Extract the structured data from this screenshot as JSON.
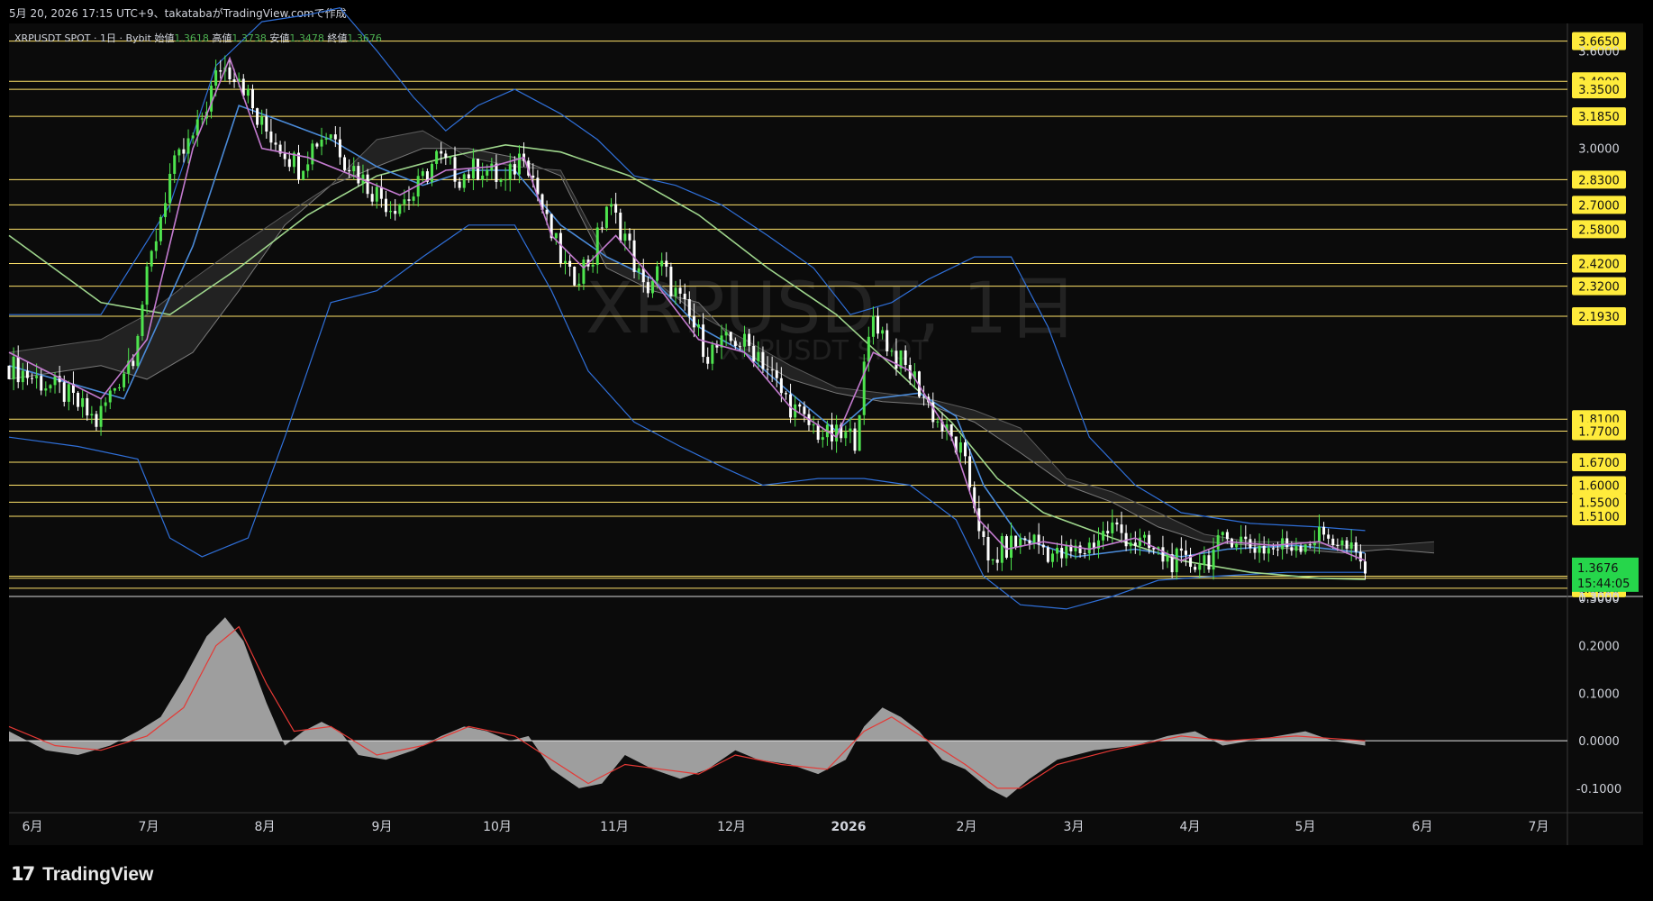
{
  "header": {
    "caption": "5月 20, 2026 17:15 UTC+9、takatabaがTradingView.comで作成"
  },
  "symbol": {
    "name": "XRPUSDT SPOT · 1日 · Bybit",
    "open_label": "始値",
    "open": "1.3618",
    "high_label": "高値",
    "high": "1.3738",
    "low_label": "安値",
    "low": "1.3478",
    "close_label": "終値",
    "close": "1.3676"
  },
  "watermark": {
    "title": "XRPUSDT, 1日",
    "subtitle": "XRPUSDT SPOT"
  },
  "footer": {
    "brand": "TradingView"
  },
  "colors": {
    "bg": "#0b0b0b",
    "up": "#4ee44e",
    "down": "#ffffff",
    "hline": "#ffe36a",
    "label_bg": "#ffeb3b",
    "price_bg": "#26d64b",
    "bb": "#2f6fd8",
    "ema_fast": "#c47bd0",
    "ema_mid": "#4a8ad8",
    "ema_slow": "#9ed58c",
    "cloud": "#7a7a7a",
    "macd": "#9e9e9e",
    "signal": "#e53935"
  },
  "chart_data": {
    "type": "candlestick",
    "symbol": "XRPUSDT SPOT",
    "timeframe": "1日",
    "exchange": "Bybit",
    "ylim": [
      1.3,
      3.7
    ],
    "y_scale": "log",
    "y_ticks": [
      "3.6000",
      "3.0000",
      "1.3000"
    ],
    "x_ticks": [
      "6月",
      "7月",
      "8月",
      "9月",
      "10月",
      "11月",
      "12月",
      "2026",
      "2月",
      "3月",
      "4月",
      "5月",
      "6月",
      "7月"
    ],
    "last_price": "1.3676",
    "countdown": "15:44:05",
    "horizontal_levels": [
      {
        "value": 3.665,
        "label": "3.6650"
      },
      {
        "value": 3.4,
        "label": "3.4000"
      },
      {
        "value": 3.35,
        "label": "3.3500"
      },
      {
        "value": 3.185,
        "label": "3.1850"
      },
      {
        "value": 2.83,
        "label": "2.8300"
      },
      {
        "value": 2.7,
        "label": "2.7000"
      },
      {
        "value": 2.58,
        "label": "2.5800"
      },
      {
        "value": 2.42,
        "label": "2.4200"
      },
      {
        "value": 2.32,
        "label": "2.3200"
      },
      {
        "value": 2.193,
        "label": "2.1930"
      },
      {
        "value": 1.81,
        "label": "1.8100"
      },
      {
        "value": 1.77,
        "label": "1.7700"
      },
      {
        "value": 1.67,
        "label": "1.6700"
      },
      {
        "value": 1.6,
        "label": "1.6000"
      },
      {
        "value": 1.55,
        "label": "1.5500"
      },
      {
        "value": 1.51,
        "label": "1.5100"
      },
      {
        "value": 1.35,
        "label": "1.3500"
      },
      {
        "value": 1.345,
        "label": "1.3450"
      },
      {
        "value": 1.32,
        "label": "1.3200"
      }
    ],
    "price_path": [
      [
        0,
        2.0
      ],
      [
        12,
        1.9
      ],
      [
        19,
        1.8
      ],
      [
        27,
        2.05
      ],
      [
        35,
        2.85
      ],
      [
        41,
        3.1
      ],
      [
        46,
        3.5
      ],
      [
        50,
        3.45
      ],
      [
        54,
        3.15
      ],
      [
        58,
        3.05
      ],
      [
        63,
        2.9
      ],
      [
        67,
        3.05
      ],
      [
        70,
        3.1
      ],
      [
        73,
        2.95
      ],
      [
        78,
        2.8
      ],
      [
        83,
        2.7
      ],
      [
        88,
        2.75
      ],
      [
        93,
        2.95
      ],
      [
        98,
        2.85
      ],
      [
        103,
        2.9
      ],
      [
        108,
        2.8
      ],
      [
        112,
        3.0
      ],
      [
        117,
        2.6
      ],
      [
        122,
        2.35
      ],
      [
        127,
        2.45
      ],
      [
        130,
        2.7
      ],
      [
        134,
        2.55
      ],
      [
        138,
        2.3
      ],
      [
        142,
        2.4
      ],
      [
        146,
        2.25
      ],
      [
        152,
        2.05
      ],
      [
        158,
        2.1
      ],
      [
        163,
        2.05
      ],
      [
        168,
        1.9
      ],
      [
        173,
        1.8
      ],
      [
        178,
        1.75
      ],
      [
        184,
        1.75
      ],
      [
        188,
        2.2
      ],
      [
        192,
        2.05
      ],
      [
        197,
        1.95
      ],
      [
        202,
        1.8
      ],
      [
        207,
        1.7
      ],
      [
        210,
        1.55
      ],
      [
        213,
        1.37
      ],
      [
        216,
        1.42
      ],
      [
        222,
        1.45
      ],
      [
        228,
        1.4
      ],
      [
        234,
        1.42
      ],
      [
        240,
        1.48
      ],
      [
        245,
        1.44
      ],
      [
        251,
        1.4
      ],
      [
        256,
        1.38
      ],
      [
        261,
        1.4
      ],
      [
        266,
        1.46
      ],
      [
        270,
        1.43
      ],
      [
        275,
        1.42
      ],
      [
        281,
        1.44
      ],
      [
        287,
        1.46
      ],
      [
        292,
        1.41
      ],
      [
        295,
        1.37
      ]
    ],
    "ema_fast": [
      [
        0,
        2.05
      ],
      [
        20,
        1.88
      ],
      [
        30,
        2.1
      ],
      [
        40,
        3.0
      ],
      [
        48,
        3.55
      ],
      [
        55,
        3.0
      ],
      [
        65,
        2.95
      ],
      [
        75,
        2.85
      ],
      [
        85,
        2.75
      ],
      [
        95,
        2.88
      ],
      [
        105,
        2.9
      ],
      [
        112,
        2.95
      ],
      [
        118,
        2.55
      ],
      [
        125,
        2.4
      ],
      [
        132,
        2.55
      ],
      [
        140,
        2.35
      ],
      [
        150,
        2.1
      ],
      [
        160,
        2.05
      ],
      [
        170,
        1.85
      ],
      [
        180,
        1.75
      ],
      [
        188,
        2.05
      ],
      [
        196,
        1.98
      ],
      [
        205,
        1.75
      ],
      [
        211,
        1.5
      ],
      [
        217,
        1.42
      ],
      [
        225,
        1.44
      ],
      [
        235,
        1.42
      ],
      [
        245,
        1.45
      ],
      [
        255,
        1.39
      ],
      [
        265,
        1.44
      ],
      [
        275,
        1.43
      ],
      [
        285,
        1.44
      ],
      [
        295,
        1.39
      ]
    ],
    "ema_mid": [
      [
        0,
        2.0
      ],
      [
        25,
        1.88
      ],
      [
        40,
        2.5
      ],
      [
        50,
        3.25
      ],
      [
        60,
        3.15
      ],
      [
        70,
        3.05
      ],
      [
        80,
        2.9
      ],
      [
        90,
        2.8
      ],
      [
        100,
        2.88
      ],
      [
        110,
        2.88
      ],
      [
        120,
        2.6
      ],
      [
        130,
        2.45
      ],
      [
        140,
        2.35
      ],
      [
        150,
        2.15
      ],
      [
        160,
        2.05
      ],
      [
        170,
        1.9
      ],
      [
        180,
        1.77
      ],
      [
        188,
        1.88
      ],
      [
        198,
        1.9
      ],
      [
        206,
        1.82
      ],
      [
        212,
        1.6
      ],
      [
        220,
        1.45
      ],
      [
        232,
        1.4
      ],
      [
        245,
        1.42
      ],
      [
        255,
        1.4
      ],
      [
        265,
        1.42
      ],
      [
        280,
        1.43
      ],
      [
        295,
        1.41
      ]
    ],
    "ema_slow": [
      [
        0,
        2.55
      ],
      [
        20,
        2.25
      ],
      [
        35,
        2.2
      ],
      [
        50,
        2.4
      ],
      [
        65,
        2.65
      ],
      [
        80,
        2.85
      ],
      [
        95,
        2.95
      ],
      [
        108,
        3.02
      ],
      [
        120,
        2.98
      ],
      [
        135,
        2.85
      ],
      [
        150,
        2.65
      ],
      [
        165,
        2.4
      ],
      [
        180,
        2.2
      ],
      [
        192,
        2.0
      ],
      [
        205,
        1.8
      ],
      [
        215,
        1.62
      ],
      [
        225,
        1.52
      ],
      [
        240,
        1.45
      ],
      [
        255,
        1.39
      ],
      [
        270,
        1.36
      ],
      [
        285,
        1.345
      ],
      [
        295,
        1.342
      ]
    ],
    "bb_upper": [
      [
        0,
        2.2
      ],
      [
        20,
        2.2
      ],
      [
        35,
        2.7
      ],
      [
        45,
        3.5
      ],
      [
        55,
        3.8
      ],
      [
        65,
        3.85
      ],
      [
        72,
        3.9
      ],
      [
        80,
        3.6
      ],
      [
        88,
        3.3
      ],
      [
        95,
        3.1
      ],
      [
        102,
        3.25
      ],
      [
        110,
        3.35
      ],
      [
        120,
        3.2
      ],
      [
        128,
        3.05
      ],
      [
        136,
        2.85
      ],
      [
        145,
        2.8
      ],
      [
        155,
        2.7
      ],
      [
        165,
        2.55
      ],
      [
        175,
        2.4
      ],
      [
        183,
        2.2
      ],
      [
        192,
        2.25
      ],
      [
        200,
        2.35
      ],
      [
        210,
        2.45
      ],
      [
        218,
        2.45
      ],
      [
        226,
        2.15
      ],
      [
        235,
        1.75
      ],
      [
        245,
        1.6
      ],
      [
        255,
        1.52
      ],
      [
        270,
        1.49
      ],
      [
        285,
        1.48
      ],
      [
        295,
        1.47
      ]
    ],
    "bb_lower": [
      [
        0,
        1.75
      ],
      [
        15,
        1.72
      ],
      [
        28,
        1.68
      ],
      [
        35,
        1.45
      ],
      [
        42,
        1.4
      ],
      [
        52,
        1.45
      ],
      [
        60,
        1.75
      ],
      [
        70,
        2.25
      ],
      [
        80,
        2.3
      ],
      [
        90,
        2.45
      ],
      [
        100,
        2.6
      ],
      [
        110,
        2.6
      ],
      [
        118,
        2.3
      ],
      [
        126,
        1.98
      ],
      [
        136,
        1.8
      ],
      [
        146,
        1.72
      ],
      [
        156,
        1.65
      ],
      [
        164,
        1.6
      ],
      [
        176,
        1.62
      ],
      [
        186,
        1.62
      ],
      [
        196,
        1.6
      ],
      [
        206,
        1.5
      ],
      [
        212,
        1.35
      ],
      [
        220,
        1.28
      ],
      [
        230,
        1.27
      ],
      [
        240,
        1.3
      ],
      [
        250,
        1.34
      ],
      [
        262,
        1.35
      ],
      [
        278,
        1.36
      ],
      [
        295,
        1.36
      ]
    ],
    "cloud_a": [
      [
        0,
        1.95
      ],
      [
        20,
        2.0
      ],
      [
        30,
        1.95
      ],
      [
        40,
        2.05
      ],
      [
        50,
        2.3
      ],
      [
        60,
        2.6
      ],
      [
        70,
        2.8
      ],
      [
        80,
        2.9
      ],
      [
        90,
        3.0
      ],
      [
        100,
        3.0
      ],
      [
        110,
        2.95
      ],
      [
        120,
        2.85
      ],
      [
        130,
        2.4
      ],
      [
        140,
        2.3
      ],
      [
        150,
        2.25
      ],
      [
        160,
        2.05
      ],
      [
        170,
        1.95
      ],
      [
        180,
        1.9
      ],
      [
        190,
        1.87
      ],
      [
        200,
        1.86
      ],
      [
        210,
        1.8
      ],
      [
        220,
        1.7
      ],
      [
        230,
        1.6
      ],
      [
        240,
        1.55
      ],
      [
        250,
        1.48
      ],
      [
        260,
        1.44
      ],
      [
        270,
        1.43
      ],
      [
        280,
        1.42
      ],
      [
        290,
        1.41
      ],
      [
        300,
        1.42
      ],
      [
        310,
        1.41
      ]
    ],
    "cloud_b": [
      [
        0,
        2.05
      ],
      [
        20,
        2.1
      ],
      [
        30,
        2.2
      ],
      [
        40,
        2.35
      ],
      [
        50,
        2.5
      ],
      [
        60,
        2.65
      ],
      [
        70,
        2.8
      ],
      [
        80,
        3.05
      ],
      [
        90,
        3.1
      ],
      [
        100,
        2.95
      ],
      [
        110,
        2.9
      ],
      [
        120,
        2.88
      ],
      [
        130,
        2.45
      ],
      [
        140,
        2.35
      ],
      [
        150,
        2.2
      ],
      [
        160,
        2.1
      ],
      [
        170,
        2.0
      ],
      [
        180,
        1.92
      ],
      [
        190,
        1.9
      ],
      [
        200,
        1.88
      ],
      [
        210,
        1.84
      ],
      [
        220,
        1.78
      ],
      [
        230,
        1.62
      ],
      [
        240,
        1.58
      ],
      [
        250,
        1.52
      ],
      [
        260,
        1.46
      ],
      [
        270,
        1.44
      ],
      [
        280,
        1.44
      ],
      [
        290,
        1.43
      ],
      [
        300,
        1.43
      ],
      [
        310,
        1.44
      ]
    ],
    "macd": {
      "ylim": [
        -0.14,
        0.3
      ],
      "y_ticks": [
        "0.3000",
        "0.2000",
        "0.1000",
        "0.0000",
        "-0.1000"
      ],
      "histogram": [
        [
          0,
          0.02
        ],
        [
          8,
          -0.02
        ],
        [
          15,
          -0.03
        ],
        [
          22,
          -0.01
        ],
        [
          28,
          0.02
        ],
        [
          33,
          0.05
        ],
        [
          38,
          0.13
        ],
        [
          43,
          0.22
        ],
        [
          47,
          0.26
        ],
        [
          51,
          0.21
        ],
        [
          56,
          0.08
        ],
        [
          60,
          -0.01
        ],
        [
          64,
          0.02
        ],
        [
          68,
          0.04
        ],
        [
          72,
          0.02
        ],
        [
          76,
          -0.03
        ],
        [
          82,
          -0.04
        ],
        [
          88,
          -0.02
        ],
        [
          94,
          0.01
        ],
        [
          99,
          0.03
        ],
        [
          104,
          0.02
        ],
        [
          109,
          0.0
        ],
        [
          113,
          0.01
        ],
        [
          118,
          -0.06
        ],
        [
          124,
          -0.1
        ],
        [
          129,
          -0.09
        ],
        [
          134,
          -0.03
        ],
        [
          140,
          -0.06
        ],
        [
          146,
          -0.08
        ],
        [
          152,
          -0.06
        ],
        [
          158,
          -0.02
        ],
        [
          163,
          -0.04
        ],
        [
          170,
          -0.05
        ],
        [
          176,
          -0.07
        ],
        [
          182,
          -0.04
        ],
        [
          186,
          0.03
        ],
        [
          190,
          0.07
        ],
        [
          194,
          0.05
        ],
        [
          198,
          0.02
        ],
        [
          203,
          -0.04
        ],
        [
          208,
          -0.06
        ],
        [
          213,
          -0.1
        ],
        [
          217,
          -0.12
        ],
        [
          222,
          -0.08
        ],
        [
          228,
          -0.04
        ],
        [
          236,
          -0.02
        ],
        [
          245,
          -0.01
        ],
        [
          252,
          0.01
        ],
        [
          258,
          0.02
        ],
        [
          264,
          -0.01
        ],
        [
          270,
          0.0
        ],
        [
          276,
          0.01
        ],
        [
          282,
          0.02
        ],
        [
          288,
          0.0
        ],
        [
          295,
          -0.01
        ]
      ],
      "signal": [
        [
          0,
          0.03
        ],
        [
          10,
          -0.01
        ],
        [
          20,
          -0.02
        ],
        [
          30,
          0.01
        ],
        [
          38,
          0.07
        ],
        [
          45,
          0.2
        ],
        [
          50,
          0.24
        ],
        [
          56,
          0.12
        ],
        [
          62,
          0.02
        ],
        [
          70,
          0.03
        ],
        [
          80,
          -0.03
        ],
        [
          90,
          -0.01
        ],
        [
          100,
          0.03
        ],
        [
          110,
          0.01
        ],
        [
          118,
          -0.04
        ],
        [
          126,
          -0.09
        ],
        [
          134,
          -0.05
        ],
        [
          142,
          -0.06
        ],
        [
          150,
          -0.07
        ],
        [
          158,
          -0.03
        ],
        [
          168,
          -0.05
        ],
        [
          178,
          -0.06
        ],
        [
          186,
          0.02
        ],
        [
          192,
          0.05
        ],
        [
          200,
          0.0
        ],
        [
          208,
          -0.05
        ],
        [
          215,
          -0.1
        ],
        [
          220,
          -0.1
        ],
        [
          228,
          -0.05
        ],
        [
          240,
          -0.02
        ],
        [
          255,
          0.01
        ],
        [
          265,
          0.0
        ],
        [
          280,
          0.01
        ],
        [
          295,
          0.0
        ]
      ]
    }
  }
}
